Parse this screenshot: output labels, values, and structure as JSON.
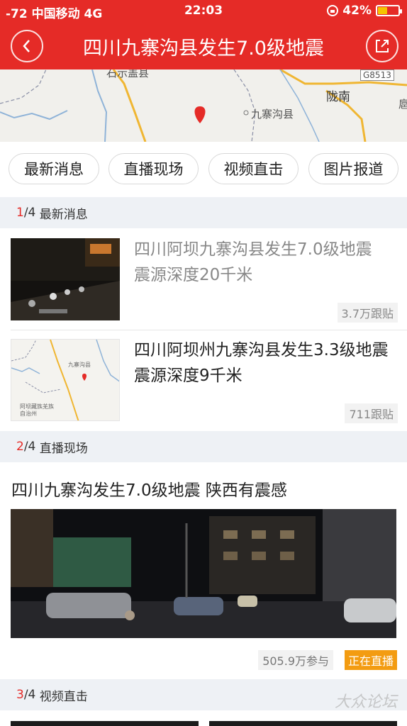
{
  "status_bar": {
    "carrier": "-72 中国移动 4G",
    "time": "22:03",
    "battery": "42%",
    "battery_level": 0.42
  },
  "header": {
    "title": "四川九寨沟县发生7.0级地震",
    "back_icon": "chevron-left-icon",
    "share_icon": "share-arrow-icon",
    "bg_color": "#e52b27"
  },
  "map": {
    "labels": {
      "road": "G8513",
      "city": "陇南",
      "county": "九寨沟县",
      "top_left": "石示盖县",
      "right_edge": "扈"
    },
    "marker_color": "#e52b27"
  },
  "tabs": [
    "最新消息",
    "直播现场",
    "视频直击",
    "图片报道"
  ],
  "sections": [
    {
      "index": "1",
      "total": "/4",
      "label": "最新消息"
    },
    {
      "index": "2",
      "total": "/4",
      "label": "直播现场"
    },
    {
      "index": "3",
      "total": "/4",
      "label": "视频直击"
    }
  ],
  "news": [
    {
      "title": "四川阿坝九寨沟县发生7.0级地震 震源深度20千米",
      "count": "3.7万跟贴",
      "read": true
    },
    {
      "title": "四川阿坝州九寨沟县发生3.3级地震 震源深度9千米",
      "count": "711跟贴",
      "read": false
    }
  ],
  "thumb_map_labels": [
    "阿坝藏族羌族自治州",
    "九寨沟县"
  ],
  "live": {
    "title": "四川九寨沟发生7.0级地震 陕西有震感",
    "participants": "505.9万参与",
    "badge": "正在直播",
    "badge_color": "#f39c12"
  },
  "watermark": "大众论坛"
}
